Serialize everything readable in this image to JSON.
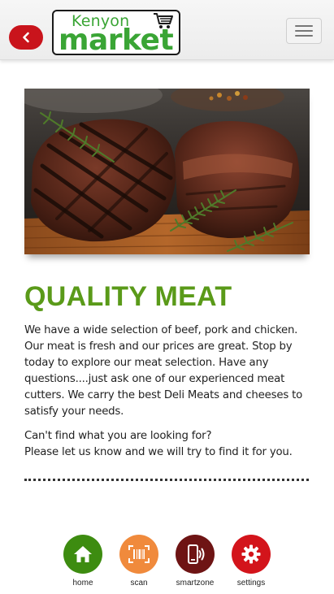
{
  "header": {
    "logo_top": "Kenyon",
    "logo_main": "market"
  },
  "content": {
    "title": "QUALITY MEAT",
    "description": "We have a wide selection of beef, pork and chicken. Our meat is fresh and our prices are great. Stop by today to explore our meat selection. Have any questions....just ask one of our experienced meat cutters. We carry the best Deli Meats and cheeses to satisfy your needs.",
    "cant_find_line1": "Can't find what you are looking for?",
    "cant_find_line2": "Please let us know and we will try to find it for you."
  },
  "nav": {
    "items": [
      {
        "label": "home",
        "icon": "home-icon",
        "color": "#3d8c10"
      },
      {
        "label": "scan",
        "icon": "barcode-scan-icon",
        "color": "#f08a3c"
      },
      {
        "label": "smartzone",
        "icon": "phone-signal-icon",
        "color": "#6e1414"
      },
      {
        "label": "settings",
        "icon": "gear-icon",
        "color": "#d3141b"
      }
    ]
  },
  "colors": {
    "accent_green": "#5a9a19",
    "logo_green": "#3aa535",
    "back_red": "#c9141c"
  }
}
